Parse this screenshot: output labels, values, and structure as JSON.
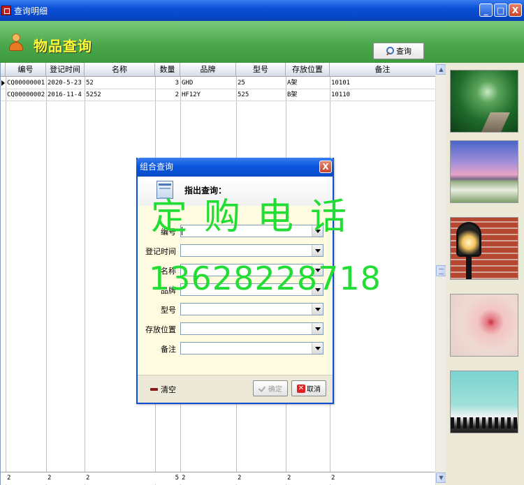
{
  "window": {
    "title": "查询明细",
    "minimize": "_",
    "maximize": "□",
    "close": "X"
  },
  "header": {
    "title": "物品查询",
    "query_button": "查询"
  },
  "grid": {
    "columns": [
      "编号",
      "登记时间",
      "名称",
      "数量",
      "品牌",
      "型号",
      "存放位置",
      "备注"
    ],
    "rows": [
      [
        "CQ00000001",
        "2020-5-23",
        "52",
        "3",
        "GHD",
        "25",
        "A架",
        "10101"
      ],
      [
        "CQ00000002",
        "2016-11-4",
        "5252",
        "2",
        "HF12Y",
        "525",
        "B架",
        "10110"
      ]
    ],
    "summary": [
      "2",
      "2",
      "2",
      "5",
      "2",
      "2",
      "2",
      "2"
    ]
  },
  "dialog": {
    "title": "组合查询",
    "close": "X",
    "banner": "指出查询：",
    "fields": [
      "编号",
      "登记时间",
      "名称",
      "品牌",
      "型号",
      "存放位置",
      "备注"
    ],
    "clear": "清空",
    "ok": "确定",
    "cancel": "取消"
  },
  "watermark": {
    "line1": "定购电话",
    "line2": "13628228718"
  },
  "colors": {
    "titlebar": "#0a4fd6",
    "header_green": "#4aa64a",
    "header_title": "#ffff33",
    "watermark": "#22dd33"
  }
}
